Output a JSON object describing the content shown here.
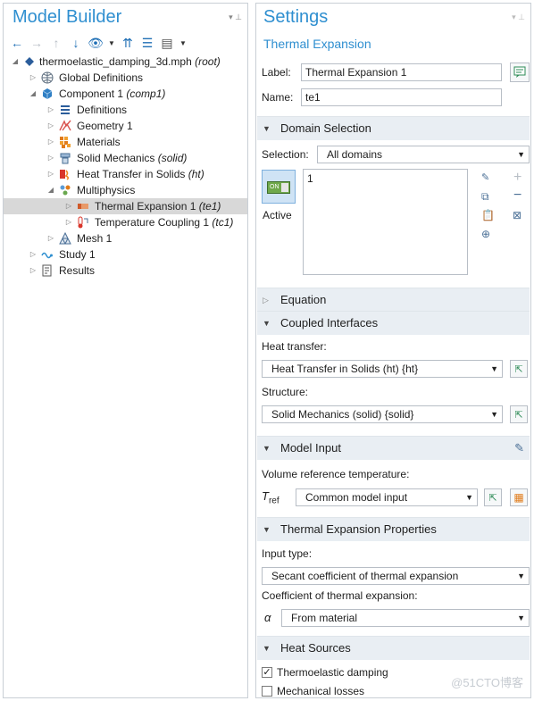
{
  "model_builder": {
    "title": "Model Builder",
    "tree": [
      {
        "label": "thermoelastic_damping_3d.mph",
        "tag": "(root)",
        "icon": "root-model-icon"
      },
      {
        "label": "Global Definitions",
        "tag": "",
        "icon": "globe-icon"
      },
      {
        "label": "Component 1",
        "tag": "(comp1)",
        "icon": "component-icon"
      },
      {
        "label": "Definitions",
        "tag": "",
        "icon": "definitions-icon"
      },
      {
        "label": "Geometry 1",
        "tag": "",
        "icon": "geometry-icon"
      },
      {
        "label": "Materials",
        "tag": "",
        "icon": "materials-icon"
      },
      {
        "label": "Solid Mechanics",
        "tag": "(solid)",
        "icon": "solid-mechanics-icon"
      },
      {
        "label": "Heat Transfer in Solids",
        "tag": "(ht)",
        "icon": "heat-transfer-icon"
      },
      {
        "label": "Multiphysics",
        "tag": "",
        "icon": "multiphysics-icon"
      },
      {
        "label": "Thermal Expansion 1",
        "tag": "(te1)",
        "icon": "thermal-expansion-icon"
      },
      {
        "label": "Temperature Coupling 1",
        "tag": "(tc1)",
        "icon": "temperature-coupling-icon"
      },
      {
        "label": "Mesh 1",
        "tag": "",
        "icon": "mesh-icon"
      },
      {
        "label": "Study 1",
        "tag": "",
        "icon": "study-icon"
      },
      {
        "label": "Results",
        "tag": "",
        "icon": "results-icon"
      }
    ]
  },
  "settings": {
    "title": "Settings",
    "subtitle": "Thermal Expansion",
    "label_field": {
      "label": "Label:",
      "value": "Thermal Expansion 1"
    },
    "name_field": {
      "label": "Name:",
      "value": "te1"
    },
    "domain_selection": {
      "title": "Domain Selection",
      "selection_label": "Selection:",
      "selection_value": "All domains",
      "list_item": "1",
      "active_toggle": "ON",
      "active_label": "Active"
    },
    "equation": {
      "title": "Equation"
    },
    "coupled_interfaces": {
      "title": "Coupled Interfaces",
      "heat_label": "Heat transfer:",
      "heat_value": "Heat Transfer in Solids (ht) {ht}",
      "structure_label": "Structure:",
      "structure_value": "Solid Mechanics (solid) {solid}"
    },
    "model_input": {
      "title": "Model Input",
      "vref_label": "Volume reference temperature:",
      "symbol_main": "T",
      "symbol_sub": "ref",
      "vref_value": "Common model input"
    },
    "thermal_expansion_properties": {
      "title": "Thermal Expansion Properties",
      "input_type_label": "Input type:",
      "input_type_value": "Secant coefficient of thermal expansion",
      "coef_label": "Coefficient of thermal expansion:",
      "alpha": "α",
      "coef_value": "From material"
    },
    "heat_sources": {
      "title": "Heat Sources",
      "thermoelastic_damping": {
        "label": "Thermoelastic damping",
        "checked": true
      },
      "mechanical_losses": {
        "label": "Mechanical losses",
        "checked": false
      }
    }
  },
  "watermark": "@51CTO博客",
  "colors": {
    "accent": "#2f8fd0",
    "section_bg": "#e9eef3",
    "selected_row": "#d8d8d8"
  }
}
